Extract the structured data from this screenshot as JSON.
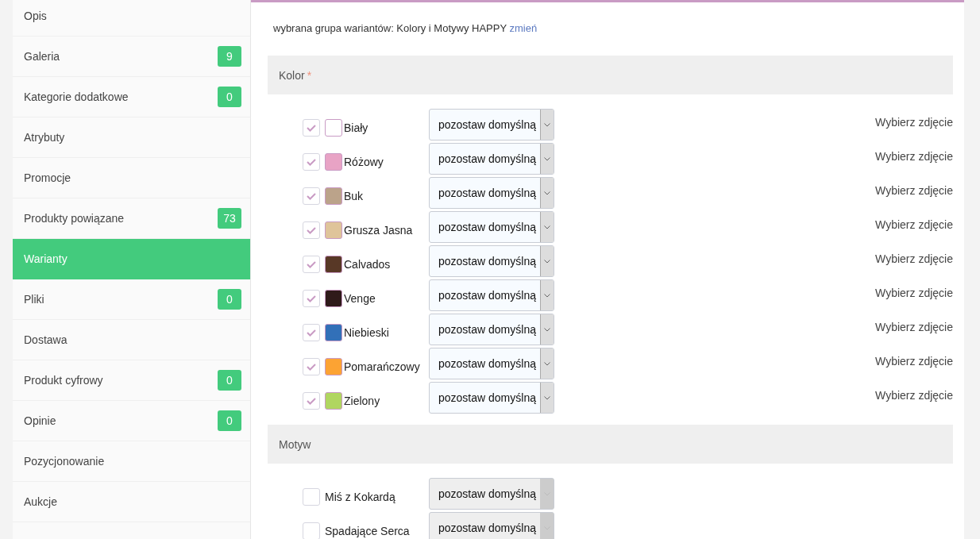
{
  "sidebar": {
    "items": [
      {
        "label": "Opis",
        "selected": false
      },
      {
        "label": "Galeria",
        "badge": "9",
        "selected": false
      },
      {
        "label": "Kategorie dodatkowe",
        "badge": "0",
        "selected": false
      },
      {
        "label": "Atrybuty",
        "selected": false
      },
      {
        "label": "Promocje",
        "selected": false
      },
      {
        "label": "Produkty powiązane",
        "badge": "73",
        "selected": false
      },
      {
        "label": "Warianty",
        "selected": true
      },
      {
        "label": "Pliki",
        "badge": "0",
        "selected": false
      },
      {
        "label": "Dostawa",
        "selected": false
      },
      {
        "label": "Produkt cyfrowy",
        "badge": "0",
        "selected": false
      },
      {
        "label": "Opinie",
        "badge": "0",
        "selected": false
      },
      {
        "label": "Pozycjonowanie",
        "selected": false
      },
      {
        "label": "Aukcje",
        "selected": false
      }
    ]
  },
  "variant_group": {
    "text": "wybrana grupa wariantów: Kolory i Motywy HAPPY",
    "link": "zmień"
  },
  "sections": [
    {
      "title": "Kolor",
      "required_mark": "*",
      "options": [
        {
          "label": "Biały",
          "checked": true,
          "color": "#ffffff",
          "select": {
            "value": "pozostaw domyślną",
            "disabled": false
          },
          "photo_link": "Wybierz zdjęcie"
        },
        {
          "label": "Różowy",
          "checked": true,
          "color": "#e8a3c5",
          "select": {
            "value": "pozostaw domyślną",
            "disabled": false
          },
          "photo_link": "Wybierz zdjęcie"
        },
        {
          "label": "Buk",
          "checked": true,
          "color": "#bba38a",
          "select": {
            "value": "pozostaw domyślną",
            "disabled": false
          },
          "photo_link": "Wybierz zdjęcie"
        },
        {
          "label": "Grusza Jasna",
          "checked": true,
          "color": "#dfc49a",
          "select": {
            "value": "pozostaw domyślną",
            "disabled": false
          },
          "photo_link": "Wybierz zdjęcie"
        },
        {
          "label": "Calvados",
          "checked": true,
          "color": "#583826",
          "select": {
            "value": "pozostaw domyślną",
            "disabled": false
          },
          "photo_link": "Wybierz zdjęcie"
        },
        {
          "label": "Venge",
          "checked": true,
          "color": "#2f1a1a",
          "select": {
            "value": "pozostaw domyślną",
            "disabled": false
          },
          "photo_link": "Wybierz zdjęcie"
        },
        {
          "label": "Niebieski",
          "checked": true,
          "color": "#3270b8",
          "select": {
            "value": "pozostaw domyślną",
            "disabled": false
          },
          "photo_link": "Wybierz zdjęcie"
        },
        {
          "label": "Pomarańczowy",
          "checked": true,
          "color": "#fca333",
          "select": {
            "value": "pozostaw domyślną",
            "disabled": false
          },
          "photo_link": "Wybierz zdjęcie"
        },
        {
          "label": "Zielony",
          "checked": true,
          "color": "#b0d660",
          "select": {
            "value": "pozostaw domyślną",
            "disabled": false
          },
          "photo_link": "Wybierz zdjęcie"
        }
      ]
    },
    {
      "title": "Motyw",
      "options": [
        {
          "label": "Miś z Kokardą",
          "checked": false,
          "select": {
            "value": "pozostaw domyślną",
            "disabled": true
          }
        },
        {
          "label": "Spadające Serca",
          "checked": false,
          "select": {
            "value": "pozostaw domyślną",
            "disabled": true
          }
        }
      ]
    }
  ]
}
